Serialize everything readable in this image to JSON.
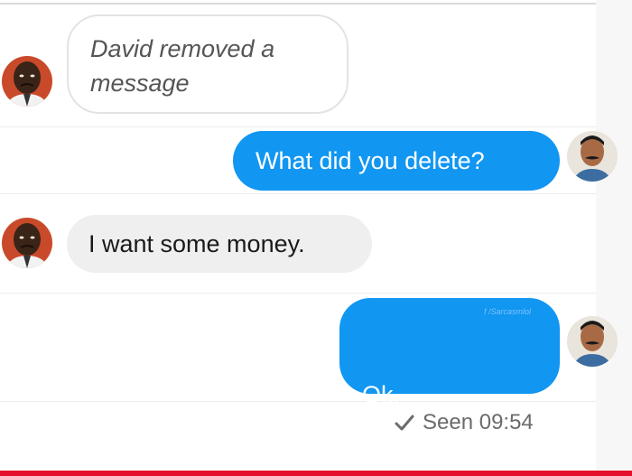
{
  "conversation": {
    "messages": [
      {
        "sender": "David",
        "direction": "incoming",
        "text": "David removed a message",
        "removed": true
      },
      {
        "sender": "Me",
        "direction": "outgoing",
        "text": "What did you delete?"
      },
      {
        "sender": "David",
        "direction": "incoming",
        "text": "I want some money."
      },
      {
        "sender": "Me",
        "direction": "outgoing",
        "text": "Ok.\nDelete again.",
        "watermark": "f /Sarcasmlol"
      }
    ],
    "status": {
      "icon": "checkmark-icon",
      "text": "Seen 09:54"
    }
  },
  "colors": {
    "outgoing_bubble": "#1196f2",
    "incoming_bubble": "#efefef",
    "bottom_accent": "#e3122a"
  }
}
